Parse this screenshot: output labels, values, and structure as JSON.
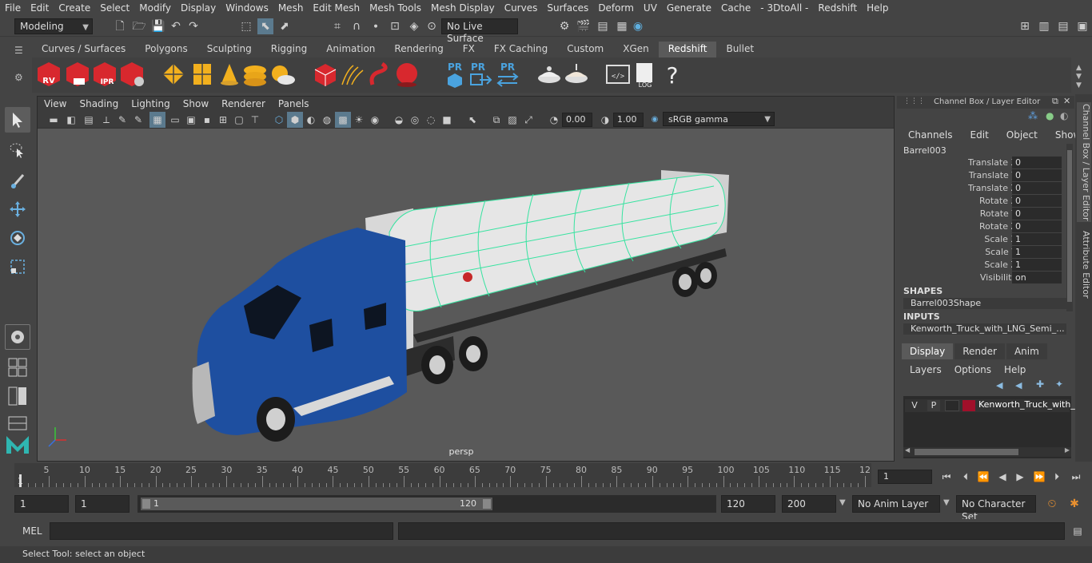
{
  "menubar": [
    "File",
    "Edit",
    "Create",
    "Select",
    "Modify",
    "Display",
    "Windows",
    "Mesh",
    "Edit Mesh",
    "Mesh Tools",
    "Mesh Display",
    "Curves",
    "Surfaces",
    "Deform",
    "UV",
    "Generate",
    "Cache",
    "- 3DtoAll -",
    "Redshift",
    "Help"
  ],
  "statusline": {
    "mode": "Modeling",
    "live_surface": "No Live Surface"
  },
  "shelf_tabs": [
    "Curves / Surfaces",
    "Polygons",
    "Sculpting",
    "Rigging",
    "Animation",
    "Rendering",
    "FX",
    "FX Caching",
    "Custom",
    "XGen",
    "Redshift",
    "Bullet"
  ],
  "shelf_active_tab": "Redshift",
  "shelf_labels": {
    "rv": "RV",
    "ipr": "IPR",
    "pr1": "PR",
    "pr2": "PR",
    "pr3": "PR",
    "log": "LOG",
    "help": "?"
  },
  "viewport": {
    "menu": [
      "View",
      "Shading",
      "Lighting",
      "Show",
      "Renderer",
      "Panels"
    ],
    "exposure": "0.00",
    "gamma": "1.00",
    "color_space": "sRGB gamma",
    "camera_label": "persp"
  },
  "channelbox": {
    "title": "Channel Box / Layer Editor",
    "menu": [
      "Channels",
      "Edit",
      "Object",
      "Show"
    ],
    "object_name": "Barrel003",
    "attributes": [
      {
        "label": "Translate X",
        "value": "0"
      },
      {
        "label": "Translate Y",
        "value": "0"
      },
      {
        "label": "Translate Z",
        "value": "0"
      },
      {
        "label": "Rotate X",
        "value": "0"
      },
      {
        "label": "Rotate Y",
        "value": "0"
      },
      {
        "label": "Rotate Z",
        "value": "0"
      },
      {
        "label": "Scale X",
        "value": "1"
      },
      {
        "label": "Scale Y",
        "value": "1"
      },
      {
        "label": "Scale Z",
        "value": "1"
      },
      {
        "label": "Visibility",
        "value": "on"
      }
    ],
    "shapes_header": "SHAPES",
    "shape_name": "Barrel003Shape",
    "inputs_header": "INPUTS",
    "input_name": "Kenworth_Truck_with_LNG_Semi_...",
    "layer_tabs": [
      "Display",
      "Render",
      "Anim"
    ],
    "layer_menu": [
      "Layers",
      "Options",
      "Help"
    ],
    "layer": {
      "v": "V",
      "p": "P",
      "name": "Kenworth_Truck_with_",
      "color": "#a0102a"
    }
  },
  "side_tabs": [
    "Channel Box / Layer Editor",
    "Attribute Editor"
  ],
  "timeslider": {
    "ticks": [
      "5",
      "10",
      "15",
      "20",
      "25",
      "30",
      "35",
      "40",
      "45",
      "50",
      "55",
      "60",
      "65",
      "70",
      "75",
      "80",
      "85",
      "90",
      "95",
      "100",
      "105",
      "110",
      "115",
      "12"
    ],
    "start_marker": "1",
    "current_frame": "1"
  },
  "rangeslider": {
    "start": "1",
    "playback_start": "1",
    "range_inner_start": "1",
    "range_inner_end": "120",
    "playback_end": "120",
    "end": "200",
    "anim_layer": "No Anim Layer",
    "character_set": "No Character Set"
  },
  "cmdline": {
    "label": "MEL"
  },
  "helpline": {
    "text": "Select Tool: select an object"
  },
  "colors": {
    "accent": "#5285a6",
    "blue_truck": "#1e4fa0",
    "wireframe": "#36e3a0"
  }
}
